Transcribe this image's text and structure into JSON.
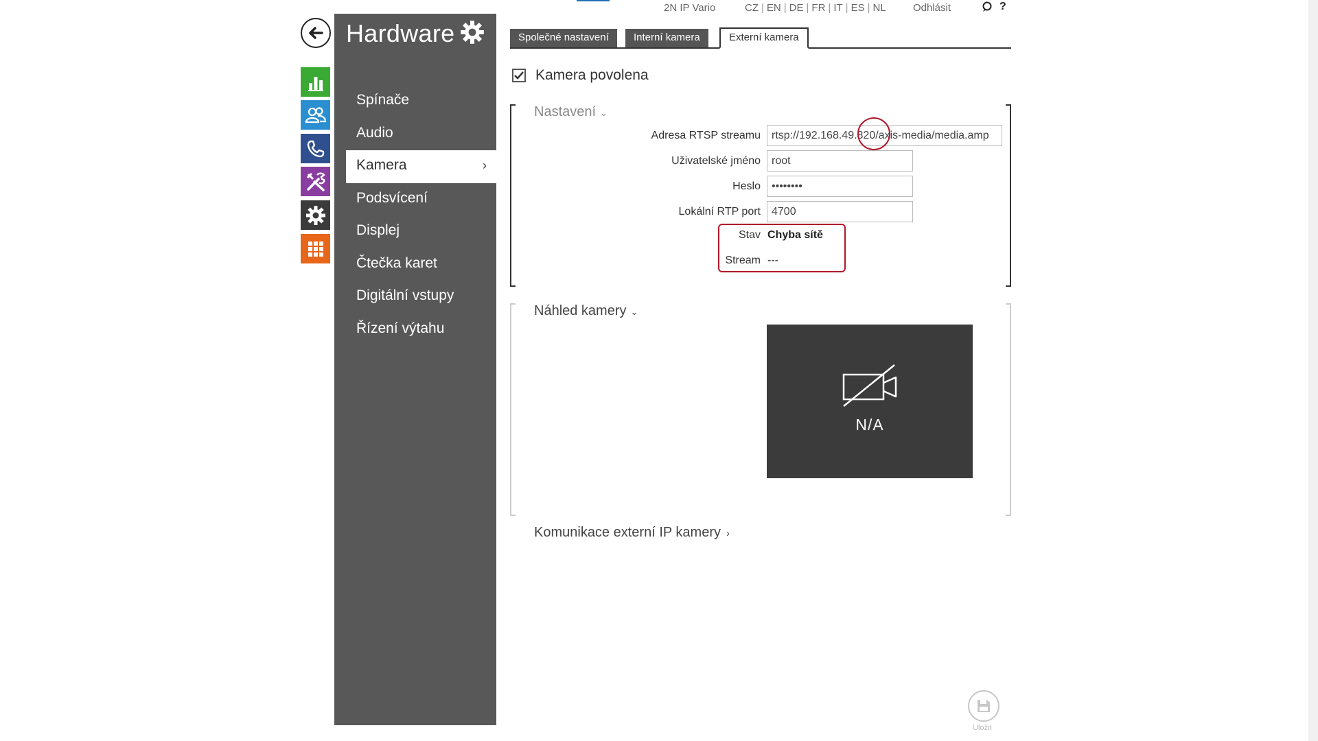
{
  "topbar": {
    "device_name": "2N IP Vario",
    "languages": [
      "CZ",
      "EN",
      "DE",
      "FR",
      "IT",
      "ES",
      "NL"
    ],
    "logout": "Odhlásit",
    "help": "?"
  },
  "rail": {
    "icons": [
      "back-arrow-icon",
      "status-chart-icon",
      "directory-users-icon",
      "calls-phone-icon",
      "services-tools-icon",
      "hardware-gear-icon",
      "system-grid-icon"
    ],
    "colors": {
      "status": "#3aaa35",
      "directory": "#2a8fd0",
      "calls": "#2f4f8f",
      "services": "#8a3da0",
      "hardware": "#3b3b3b",
      "system": "#e8661a"
    }
  },
  "side": {
    "title": "Hardware",
    "items": [
      {
        "label": "Spínače"
      },
      {
        "label": "Audio"
      },
      {
        "label": "Kamera",
        "active": true
      },
      {
        "label": "Podsvícení"
      },
      {
        "label": "Displej"
      },
      {
        "label": "Čtečka karet"
      },
      {
        "label": "Digitální vstupy"
      },
      {
        "label": "Řízení výtahu"
      }
    ]
  },
  "tabs": [
    {
      "label": "Společné nastavení"
    },
    {
      "label": "Interní kamera"
    },
    {
      "label": "Externí kamera",
      "active": true
    }
  ],
  "camera_enabled": {
    "label": "Kamera povolena",
    "checked": true
  },
  "settings": {
    "title": "Nastavení",
    "fields": {
      "rtsp": {
        "label": "Adresa RTSP streamu",
        "value": "rtsp://192.168.49.820/axis-media/media.amp"
      },
      "username": {
        "label": "Uživatelské jméno",
        "value": "root"
      },
      "password": {
        "label": "Heslo",
        "value": "••••••••"
      },
      "rtp_port": {
        "label": "Lokální RTP port",
        "value": "4700"
      }
    },
    "status": {
      "label": "Stav",
      "value": "Chyba sítě"
    },
    "stream": {
      "label": "Stream",
      "value": "---"
    }
  },
  "preview": {
    "title": "Náhled kamery",
    "na": "N/A"
  },
  "external_comm": {
    "label": "Komunikace externí IP kamery"
  },
  "save": {
    "label": "Uložit"
  },
  "accent_colors": {
    "annotation": "#b0192b",
    "active_tab_line": "#1f6fb5"
  }
}
